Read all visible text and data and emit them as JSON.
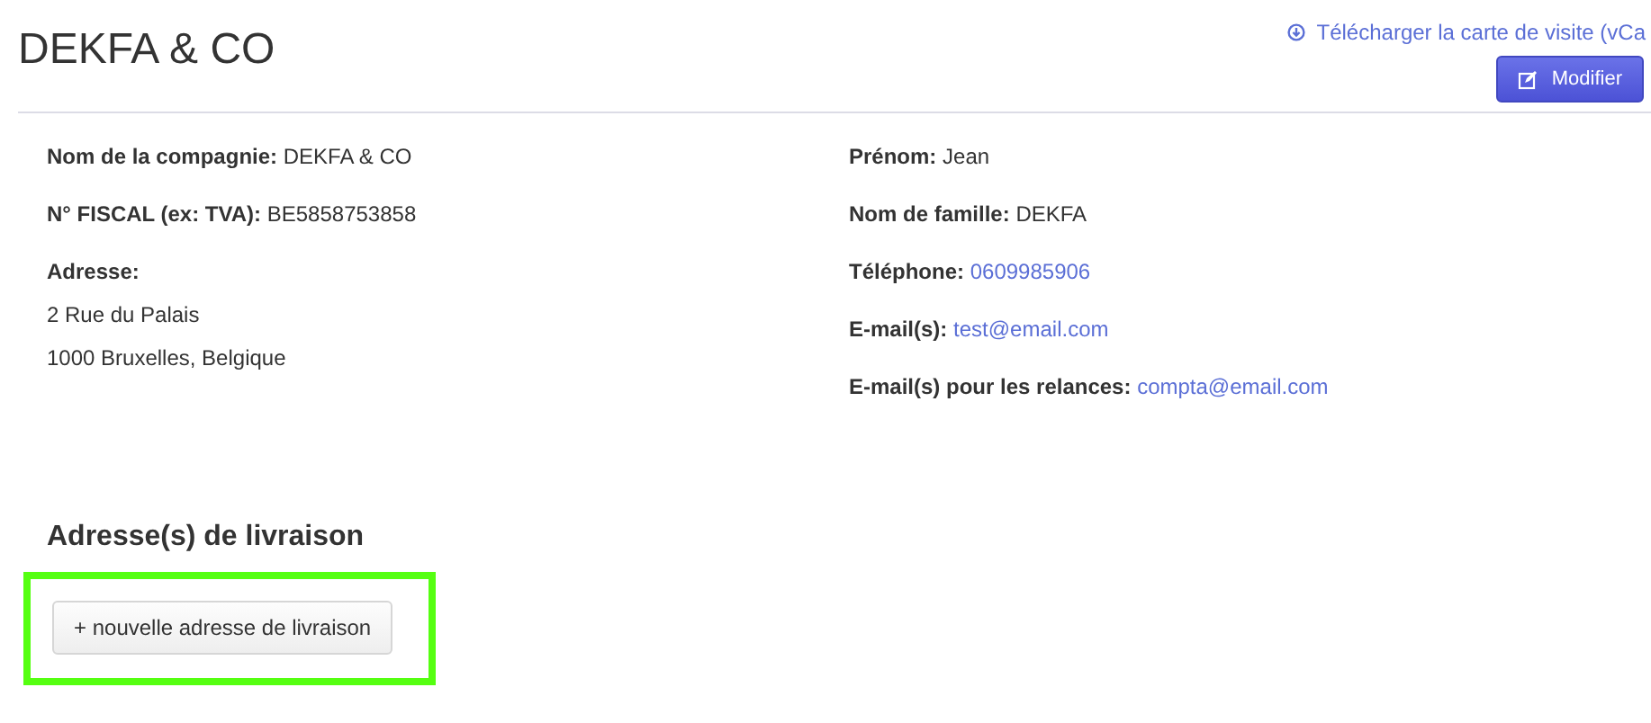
{
  "title": "DEKFA & CO",
  "download_link": "Télécharger la carte de visite (vCa",
  "edit_button": "Modifier",
  "left_fields": [
    {
      "label": "Nom de la compagnie:",
      "value": "DEKFA & CO",
      "kind": "text"
    },
    {
      "label": "N° FISCAL (ex: TVA):",
      "value": "BE5858753858",
      "kind": "text"
    },
    {
      "label": "Adresse:",
      "lines": [
        "2 Rue du Palais",
        "1000 Bruxelles, Belgique"
      ],
      "kind": "block"
    }
  ],
  "right_fields": [
    {
      "label": "Prénom:",
      "value": "Jean",
      "kind": "text"
    },
    {
      "label": "Nom de famille:",
      "value": "DEKFA",
      "kind": "text"
    },
    {
      "label": "Téléphone:",
      "value": "0609985906",
      "kind": "link"
    },
    {
      "label": "E-mail(s):",
      "value": "test@email.com",
      "kind": "link"
    },
    {
      "label": "E-mail(s) pour les relances:",
      "value": "compta@email.com",
      "kind": "link"
    }
  ],
  "delivery": {
    "heading": "Adresse(s) de livraison",
    "button": "+ nouvelle adresse de livraison",
    "highlighted": true
  }
}
